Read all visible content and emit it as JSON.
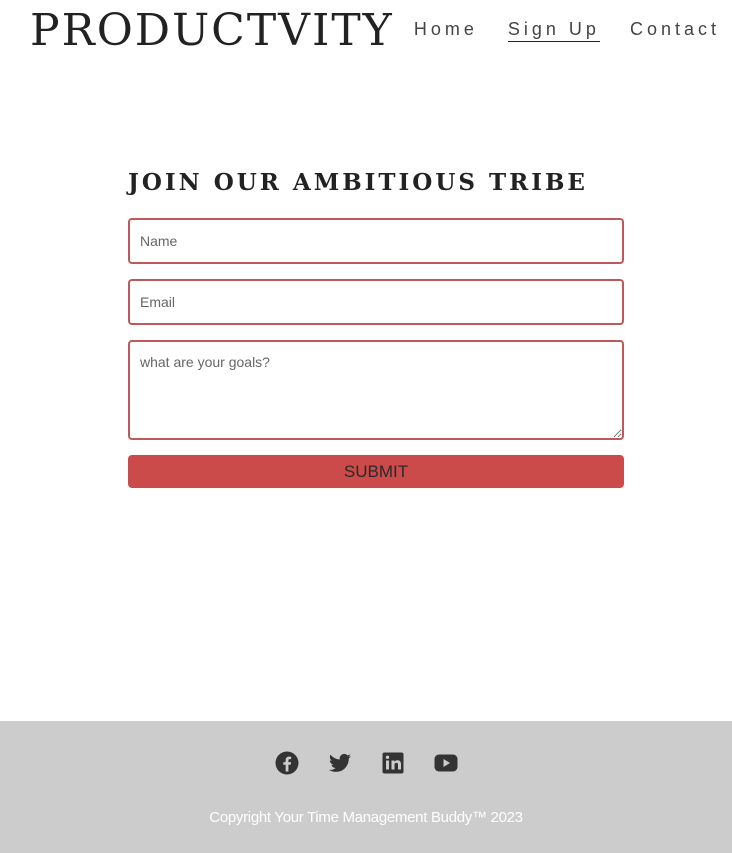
{
  "header": {
    "brand": "PRODUCTVITY",
    "nav": [
      {
        "label": "Home"
      },
      {
        "label": "Sign Up"
      },
      {
        "label": "Contact"
      }
    ]
  },
  "form": {
    "title": "JOIN OUR AMBITIOUS TRIBE",
    "name_placeholder": "Name",
    "email_placeholder": "Email",
    "goals_placeholder": "what are your goals?",
    "submit_label": "SUBMIT"
  },
  "footer": {
    "social": [
      "facebook-icon",
      "twitter-icon",
      "linkedin-icon",
      "youtube-icon"
    ],
    "copyright": "Copyright Your Time Management Buddy™ 2023"
  },
  "colors": {
    "accent": "#cb4a4a",
    "field_border": "#c0585a",
    "footer_bg": "#cccccc"
  }
}
